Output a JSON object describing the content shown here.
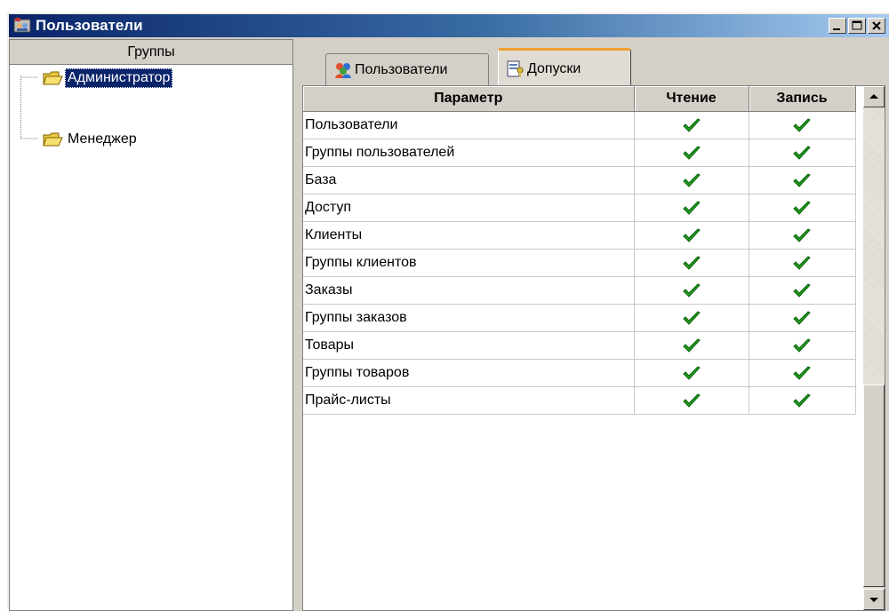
{
  "window": {
    "title": "Пользователи",
    "buttons": {
      "minimize": "minimize",
      "maximize": "maximize",
      "close": "close"
    }
  },
  "groups_panel": {
    "header": "Группы",
    "items": [
      {
        "label": "Администратор",
        "selected": true,
        "icon": "folder-icon"
      },
      {
        "label": "Менеджер",
        "selected": false,
        "icon": "folder-icon"
      }
    ]
  },
  "tabs": [
    {
      "label": "Пользователи",
      "icon": "users-icon",
      "active": false
    },
    {
      "label": "Допуски",
      "icon": "permissions-icon",
      "active": true
    }
  ],
  "permissions_table": {
    "columns": [
      "Параметр",
      "Чтение",
      "Запись"
    ],
    "rows": [
      {
        "param": "Пользователи",
        "read": true,
        "write": true
      },
      {
        "param": "Группы пользователей",
        "read": true,
        "write": true
      },
      {
        "param": "База",
        "read": true,
        "write": true
      },
      {
        "param": "Доступ",
        "read": true,
        "write": true
      },
      {
        "param": "Клиенты",
        "read": true,
        "write": true
      },
      {
        "param": "Группы клиентов",
        "read": true,
        "write": true
      },
      {
        "param": "Заказы",
        "read": true,
        "write": true
      },
      {
        "param": "Группы заказов",
        "read": true,
        "write": true
      },
      {
        "param": "Товары",
        "read": true,
        "write": true
      },
      {
        "param": "Группы товаров",
        "read": true,
        "write": true
      },
      {
        "param": "Прайс-листы",
        "read": true,
        "write": true
      }
    ]
  },
  "colors": {
    "titlebar_start": "#0a246a",
    "titlebar_end": "#a6caf0",
    "selection": "#0a246a",
    "check": "#1fa01f",
    "tab_accent": "#f0a030"
  }
}
